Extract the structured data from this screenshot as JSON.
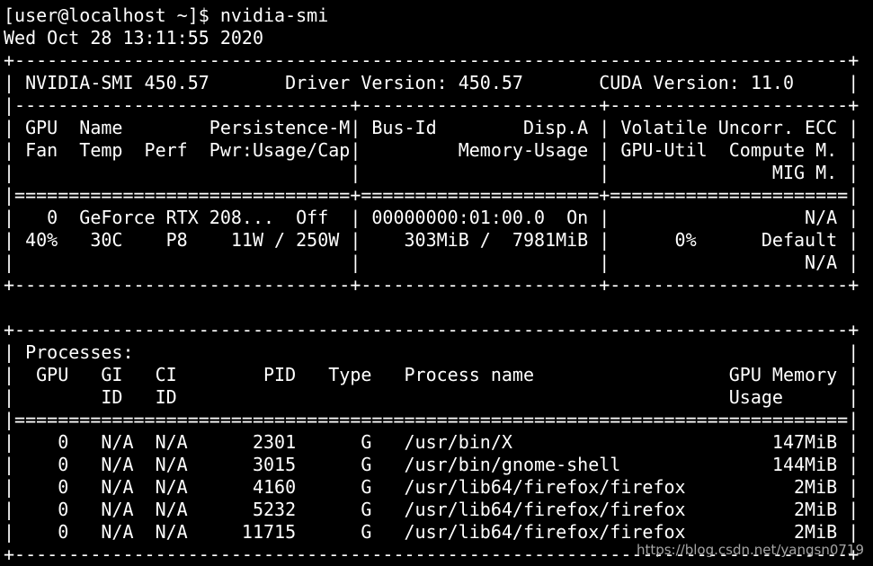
{
  "terminal": {
    "prompt": "[user@localhost ~]$ nvidia-smi",
    "timestamp": "Wed Oct 28 13:11:55 2020",
    "smi_table": [
      "+-----------------------------------------------------------------------------+",
      "| NVIDIA-SMI 450.57       Driver Version: 450.57       CUDA Version: 11.0     |",
      "|-------------------------------+----------------------+----------------------+",
      "| GPU  Name        Persistence-M| Bus-Id        Disp.A | Volatile Uncorr. ECC |",
      "| Fan  Temp  Perf  Pwr:Usage/Cap|         Memory-Usage | GPU-Util  Compute M. |",
      "|                               |                      |               MIG M. |",
      "|===============================+======================+======================|",
      "|   0  GeForce RTX 208...  Off  | 00000000:01:00.0  On |                  N/A |",
      "| 40%   30C    P8    11W / 250W |    303MiB /  7981MiB |      0%      Default |",
      "|                               |                      |                  N/A |",
      "+-------------------------------+----------------------+----------------------+"
    ],
    "processes_table": [
      "+-----------------------------------------------------------------------------+",
      "| Processes:                                                                  |",
      "|  GPU   GI   CI        PID   Type   Process name                  GPU Memory |",
      "|        ID   ID                                                   Usage      |",
      "|=============================================================================|",
      "|    0   N/A  N/A      2301      G   /usr/bin/X                        147MiB |",
      "|    0   N/A  N/A      3015      G   /usr/bin/gnome-shell              144MiB |",
      "|    0   N/A  N/A      4160      G   /usr/lib64/firefox/firefox          2MiB |",
      "|    0   N/A  N/A      5232      G   /usr/lib64/firefox/firefox          2MiB |",
      "|    0   N/A  N/A     11715      G   /usr/lib64/firefox/firefox          2MiB |",
      "+-----------------------------------------------------------------------------+"
    ]
  },
  "watermark": "https://blog.csdn.net/yangsn0719"
}
